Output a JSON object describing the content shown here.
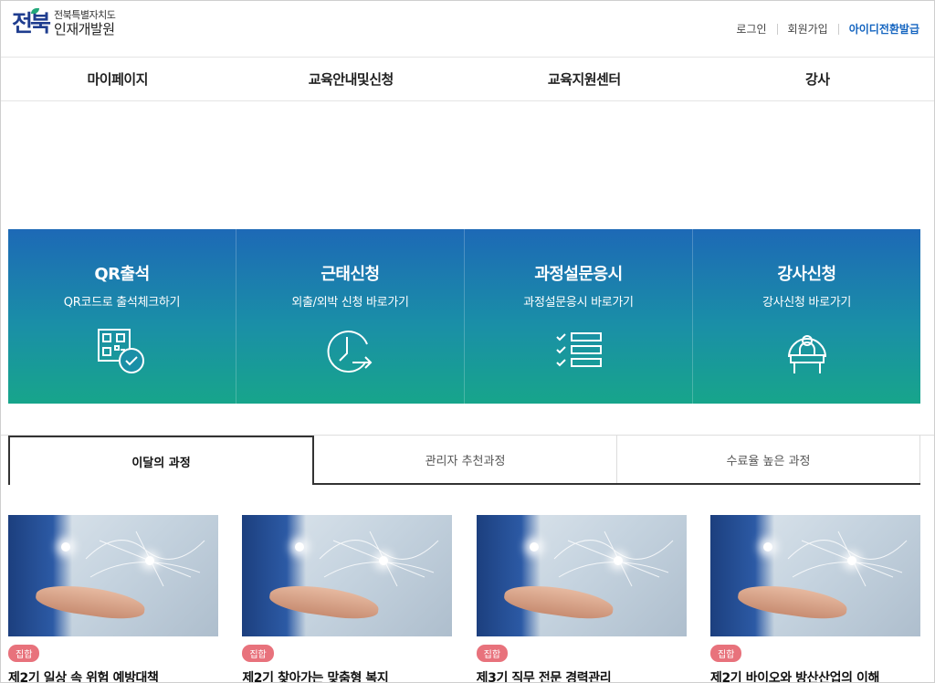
{
  "header": {
    "logo_mark": "전북",
    "logo_sub": "전북특별자치도",
    "logo_main": "인재개발원",
    "util_links": [
      "로그인",
      "회원가입",
      "아이디전환발급"
    ]
  },
  "gnb": [
    "마이페이지",
    "교육안내및신청",
    "교육지원센터",
    "강사"
  ],
  "quick_menu": [
    {
      "title": "QR출석",
      "desc": "QR코드로 출석체크하기",
      "icon": "qr-check-icon"
    },
    {
      "title": "근태신청",
      "desc": "외출/외박 신청 바로가기",
      "icon": "clock-arrow-icon"
    },
    {
      "title": "과정설문응시",
      "desc": "과정설문응시 바로가기",
      "icon": "checklist-icon"
    },
    {
      "title": "강사신청",
      "desc": "강사신청 바로가기",
      "icon": "lecturer-podium-icon"
    }
  ],
  "tabs": [
    {
      "label": "이달의 과정",
      "active": true
    },
    {
      "label": "관리자 추천과정",
      "active": false
    },
    {
      "label": "수료율 높은 과정",
      "active": false
    }
  ],
  "courses": [
    {
      "badge": "집합",
      "title": "제2기 일상 속 위험 예방대책"
    },
    {
      "badge": "집합",
      "title": "제2기 찾아가는 맞춤형 복지"
    },
    {
      "badge": "집합",
      "title": "제3기 직무 전문 경력관리"
    },
    {
      "badge": "집합",
      "title": "제2기 바이오와 방산산업의 이해"
    }
  ],
  "colors": {
    "brand": "#1f3d8f",
    "accent_link": "#1565c0",
    "quick_gradient_top": "#1d69b6",
    "quick_gradient_bottom": "#17a58b",
    "badge": "#e8727c"
  }
}
